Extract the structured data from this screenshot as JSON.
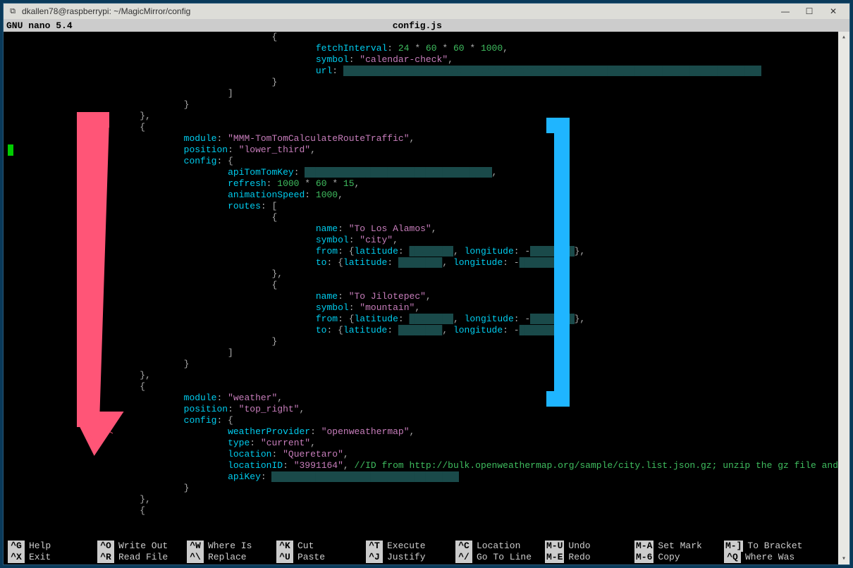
{
  "window": {
    "title": "dkallen78@raspberrypi: ~/MagicMirror/config",
    "putty_icon": "⧉"
  },
  "nano": {
    "app": "GNU nano  5.4",
    "file": "config.js"
  },
  "code": {
    "fetchInterval_parts": [
      "24",
      " * ",
      "60",
      " * ",
      "60",
      " * ",
      "1000"
    ],
    "symbol0": "\"calendar-check\"",
    "url_label": "url",
    "module1": "\"MMM-TomTomCalculateRouteTraffic\"",
    "position1": "\"lower_third\"",
    "apiKey1": "\"████████████████████████████████\"",
    "refresh_parts": [
      "1000",
      " * ",
      "60",
      " * ",
      "15"
    ],
    "animSpeed": "1000",
    "route1_name": "\"To Los Alamos\"",
    "route1_symbol": "\"city\"",
    "route2_name": "\"To Jilotepec\"",
    "route2_symbol": "\"mountain\"",
    "coord_redact": "██.█████",
    "module2": "\"weather\"",
    "position2": "\"top_right\"",
    "wprovider": "\"openweathermap\"",
    "wtype": "\"current\"",
    "wloc": "\"Queretaro\"",
    "wlocid": "\"3991164\"",
    "wcomment": "//ID from http://bulk.openweathermap.org/sample/city.list.json.gz; unzip the gz file and fi",
    "wapikey": "\"████████████████████████████████\""
  },
  "footer": {
    "r1": [
      {
        "k": "^G",
        "l": "Help"
      },
      {
        "k": "^O",
        "l": "Write Out"
      },
      {
        "k": "^W",
        "l": "Where Is"
      },
      {
        "k": "^K",
        "l": "Cut"
      },
      {
        "k": "^T",
        "l": "Execute"
      },
      {
        "k": "^C",
        "l": "Location"
      },
      {
        "k": "M-U",
        "l": "Undo"
      },
      {
        "k": "M-A",
        "l": "Set Mark"
      },
      {
        "k": "M-]",
        "l": "To Bracket"
      }
    ],
    "r2": [
      {
        "k": "^X",
        "l": "Exit"
      },
      {
        "k": "^R",
        "l": "Read File"
      },
      {
        "k": "^\\",
        "l": "Replace"
      },
      {
        "k": "^U",
        "l": "Paste"
      },
      {
        "k": "^J",
        "l": "Justify"
      },
      {
        "k": "^/",
        "l": "Go To Line"
      },
      {
        "k": "M-E",
        "l": "Redo"
      },
      {
        "k": "M-6",
        "l": "Copy"
      },
      {
        "k": "^Q",
        "l": "Where Was"
      }
    ]
  }
}
